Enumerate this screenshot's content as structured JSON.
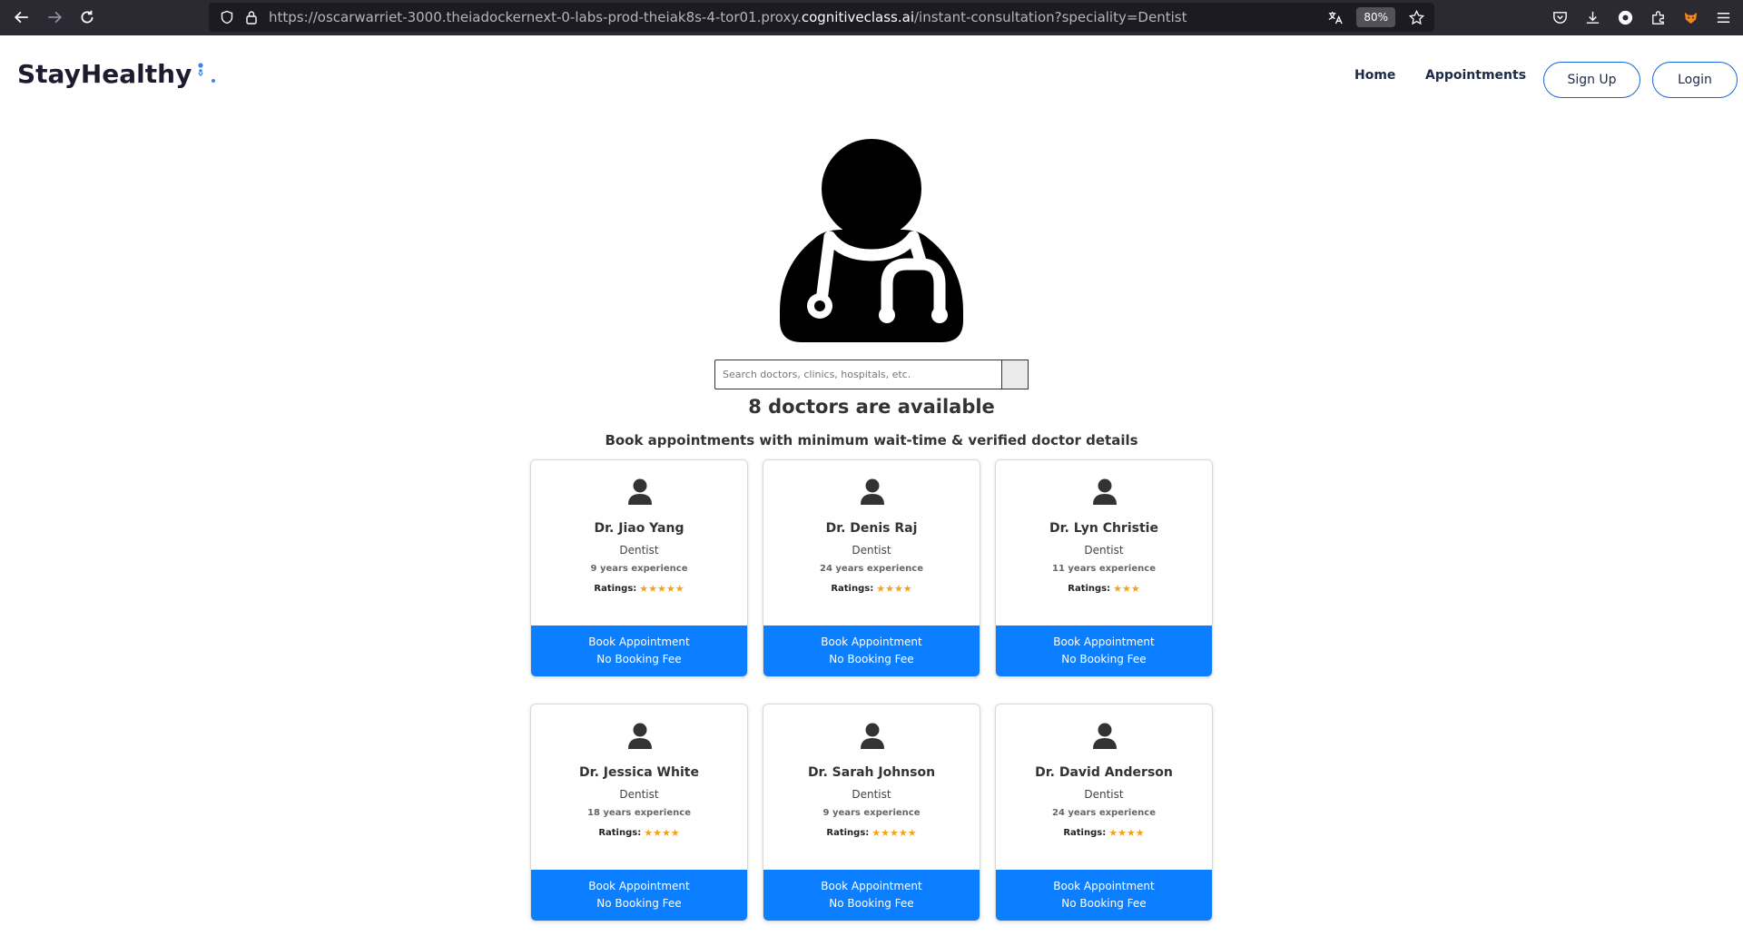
{
  "browser": {
    "url_prefix": "https://oscarwarriet-3000.theiadockernext-0-labs-prod-theiak8s-4-tor01.proxy.",
    "url_domain": "cognitiveclass.ai",
    "url_suffix": "/instant-consultation?speciality=Dentist",
    "zoom": "80%"
  },
  "header": {
    "logo_text": "StayHealthy",
    "nav": {
      "home": "Home",
      "appointments": "Appointments",
      "signup": "Sign Up",
      "login": "Login"
    }
  },
  "search": {
    "placeholder": "Search doctors, clinics, hospitals, etc."
  },
  "results": {
    "title": "8 doctors are available",
    "subtitle": "Book appointments with minimum wait-time & verified doctor details"
  },
  "doctors": [
    {
      "name": "Dr. Jiao Yang",
      "speciality": "Dentist",
      "experience": "9 years experience",
      "ratings_label": "Ratings:",
      "stars": "★★★★★",
      "rating": 5,
      "book_line1": "Book Appointment",
      "book_line2": "No Booking Fee"
    },
    {
      "name": "Dr. Denis Raj",
      "speciality": "Dentist",
      "experience": "24 years experience",
      "ratings_label": "Ratings:",
      "stars": "★★★★",
      "rating": 4,
      "book_line1": "Book Appointment",
      "book_line2": "No Booking Fee"
    },
    {
      "name": "Dr. Lyn Christie",
      "speciality": "Dentist",
      "experience": "11 years experience",
      "ratings_label": "Ratings:",
      "stars": "★★★",
      "rating": 3,
      "book_line1": "Book Appointment",
      "book_line2": "No Booking Fee"
    },
    {
      "name": "Dr. Jessica White",
      "speciality": "Dentist",
      "experience": "18 years experience",
      "ratings_label": "Ratings:",
      "stars": "★★★★",
      "rating": 4,
      "book_line1": "Book Appointment",
      "book_line2": "No Booking Fee"
    },
    {
      "name": "Dr. Sarah Johnson",
      "speciality": "Dentist",
      "experience": "9 years experience",
      "ratings_label": "Ratings:",
      "stars": "★★★★★",
      "rating": 5,
      "book_line1": "Book Appointment",
      "book_line2": "No Booking Fee"
    },
    {
      "name": "Dr. David Anderson",
      "speciality": "Dentist",
      "experience": "24 years experience",
      "ratings_label": "Ratings:",
      "stars": "★★★★",
      "rating": 4,
      "book_line1": "Book Appointment",
      "book_line2": "No Booking Fee"
    }
  ],
  "colors": {
    "accent": "#0b7fff",
    "star": "#f7a21b",
    "nav_border": "#1565d8"
  }
}
